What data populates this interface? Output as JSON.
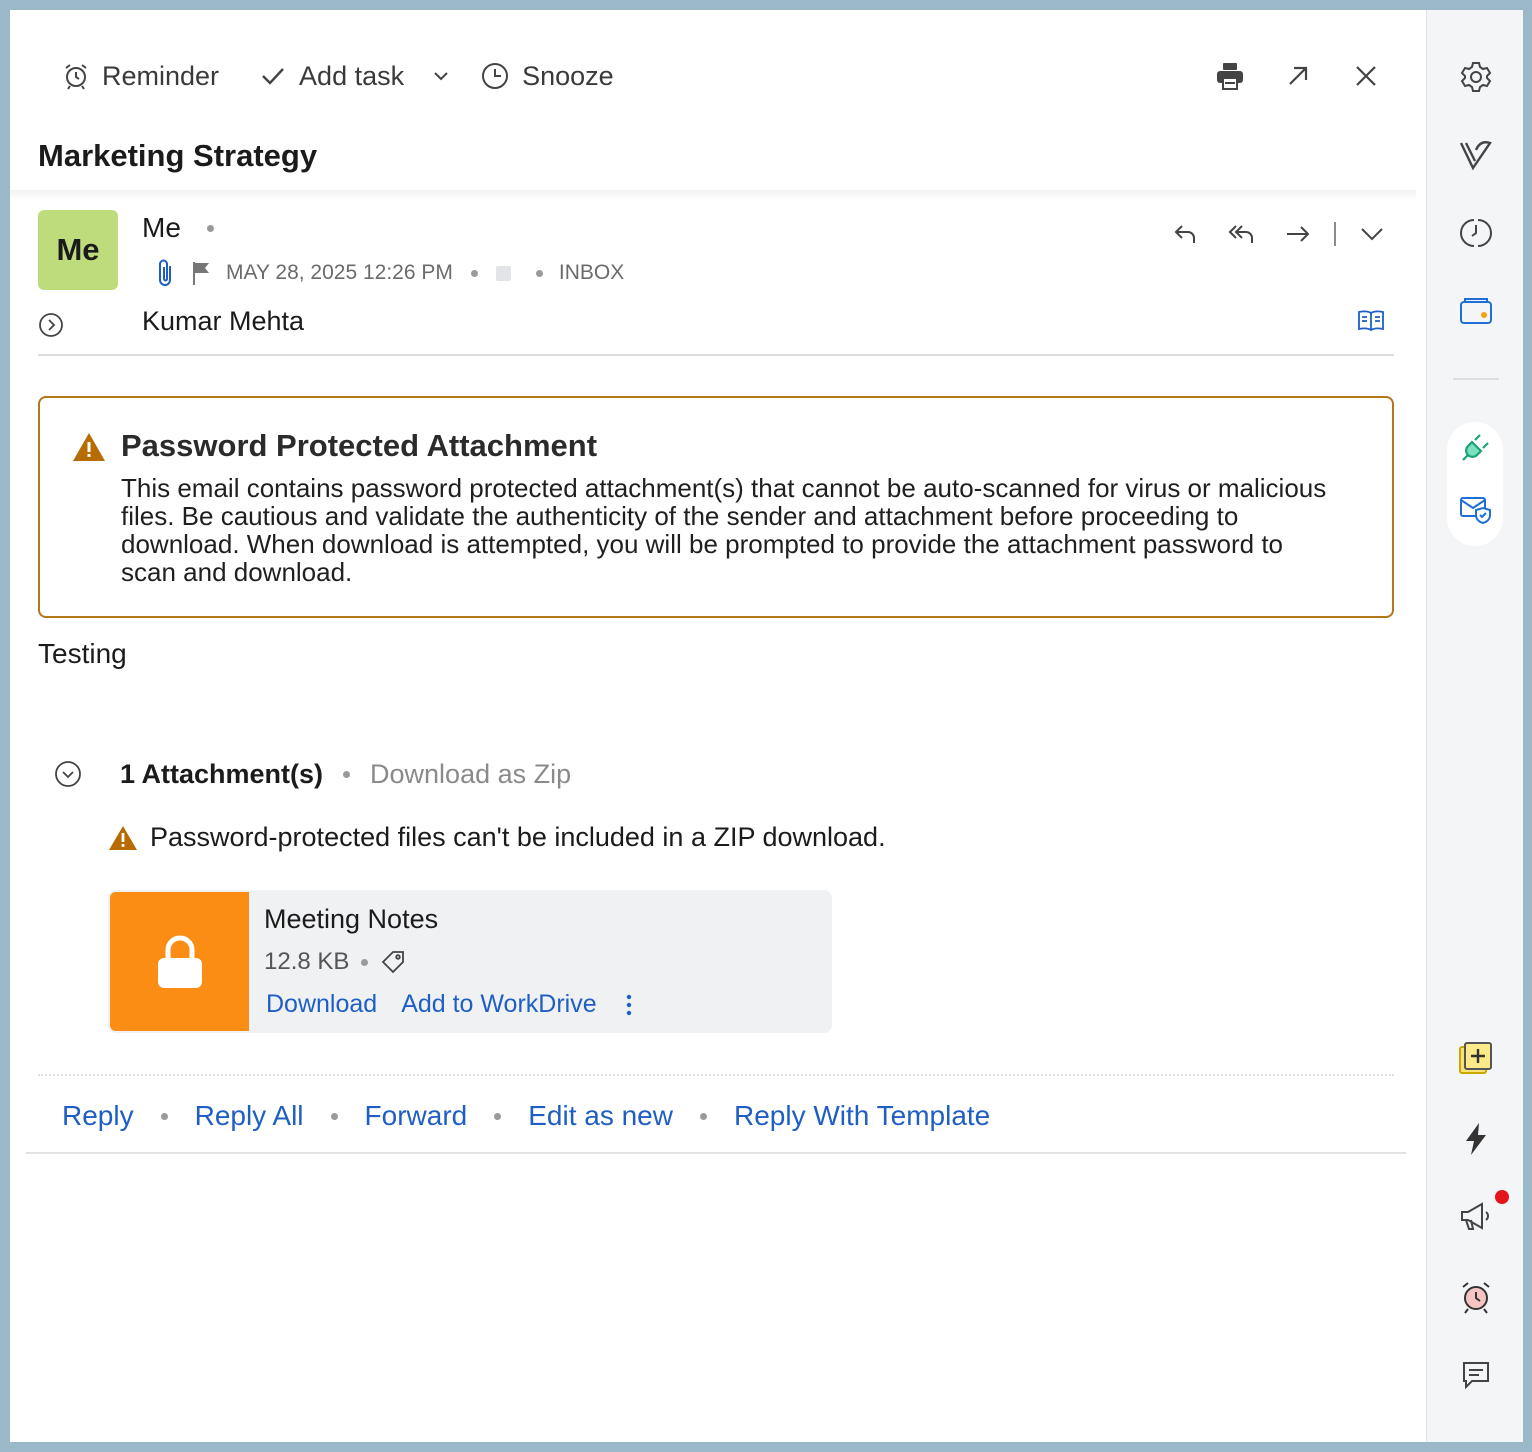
{
  "toolbar": {
    "reminder": "Reminder",
    "add_task": "Add task",
    "snooze": "Snooze"
  },
  "subject": "Marketing Strategy",
  "message": {
    "avatar_initials": "Me",
    "sender": "Me",
    "date": "MAY 28, 2025 12:26 PM",
    "folder": "INBOX",
    "to": "Kumar Mehta"
  },
  "warning": {
    "title": "Password Protected Attachment",
    "text": "This email contains password protected attachment(s) that cannot be auto-scanned for virus or malicious files. Be cautious and validate the authenticity of the sender and attachment before proceeding to download. When download is attempted, you will be prompted to provide the attachment password to scan and download."
  },
  "body": "Testing",
  "attachments": {
    "count_label": "1 Attachment(s)",
    "zip_label": "Download as Zip",
    "note": "Password-protected files can't be included in a ZIP download.",
    "file": {
      "name": "Meeting Notes",
      "size": "12.8 KB",
      "download_label": "Download",
      "workdrive_label": "Add to WorkDrive"
    }
  },
  "reply_actions": {
    "reply": "Reply",
    "reply_all": "Reply All",
    "forward": "Forward",
    "edit_as_new": "Edit as new",
    "reply_template": "Reply With Template"
  },
  "colors": {
    "accent_link": "#1f5fc4",
    "warning_border": "#b4771a",
    "warning_icon": "#b86b00",
    "attachment_thumb": "#fb8c14",
    "avatar_bg": "#bfdc7d",
    "notification_badge": "#e5141c"
  },
  "rail_icons": [
    "gear-icon",
    "zoho-logo-icon",
    "clock-split-icon",
    "wallet-icon",
    "plug-icon",
    "mail-shield-icon",
    "sticky-note-add-icon",
    "lightning-icon",
    "announcement-icon",
    "alarm-icon",
    "chat-icon"
  ]
}
